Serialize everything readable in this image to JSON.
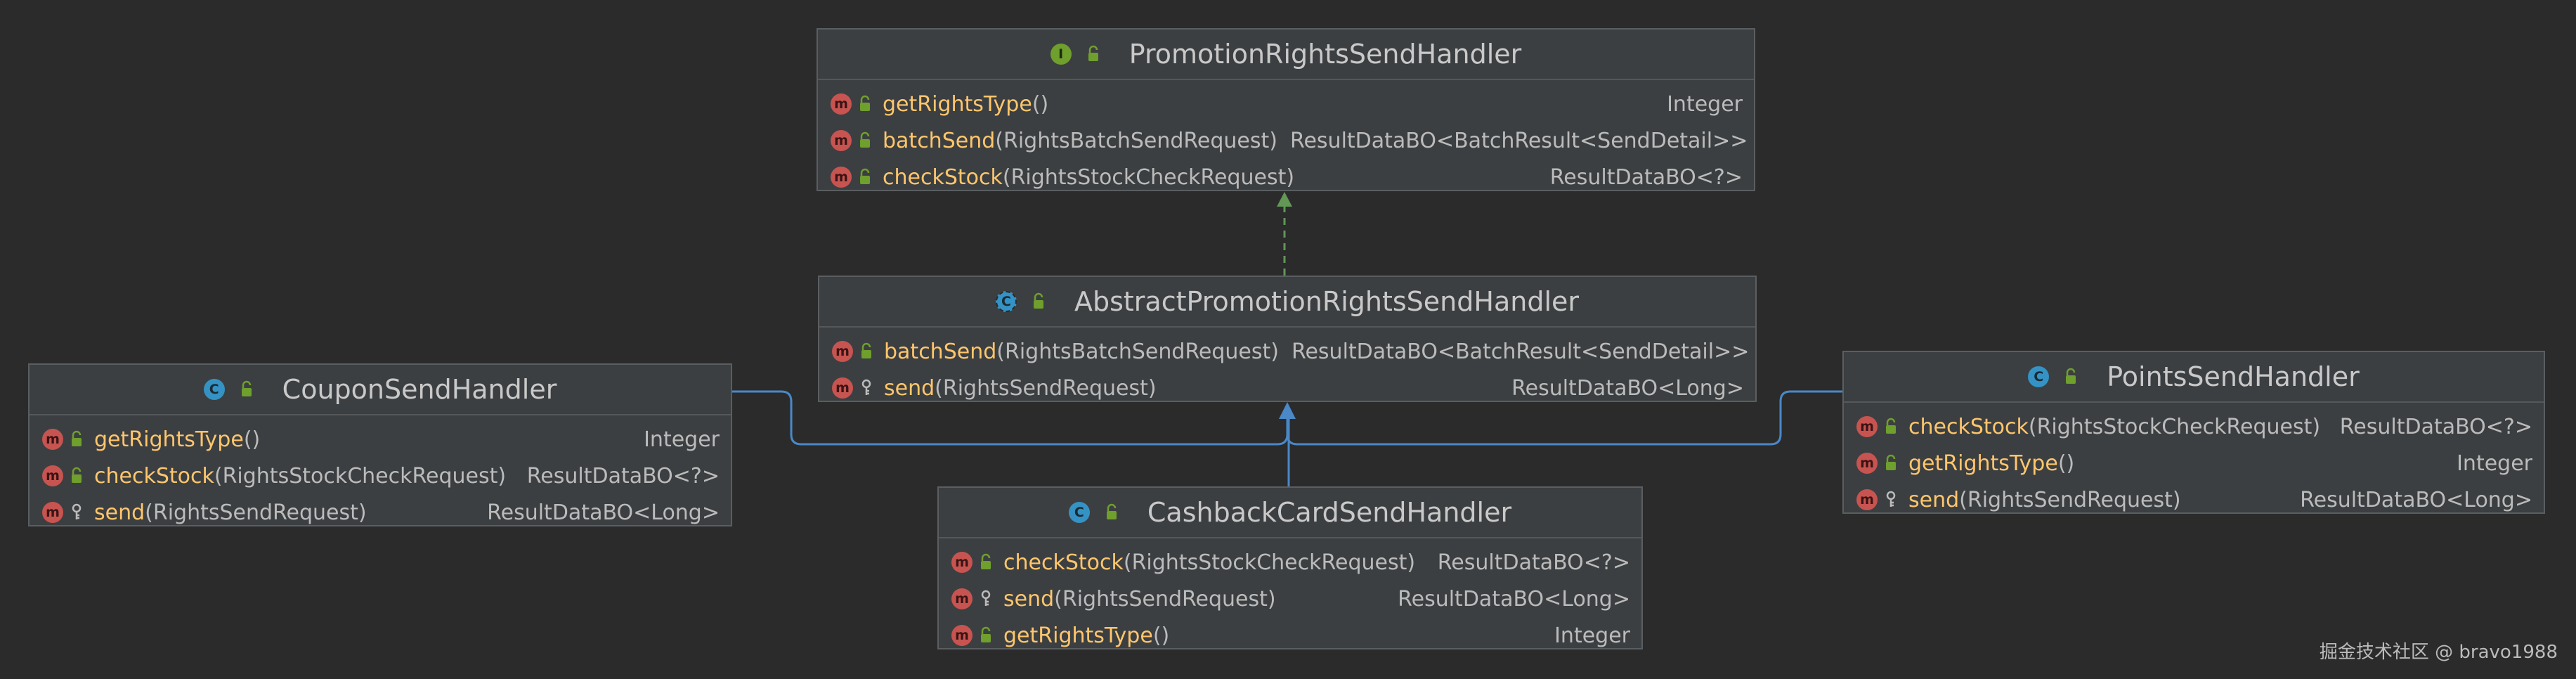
{
  "classes": {
    "promotion": {
      "name": "PromotionRightsSendHandler",
      "kind_icon": "interface-icon",
      "kind_letter": "I",
      "methods": [
        {
          "name": "getRightsType",
          "params": "()",
          "ret": "Integer",
          "visibility": "public-lock-icon"
        },
        {
          "name": "batchSend",
          "params": "(RightsBatchSendRequest)",
          "ret": "ResultDataBO<BatchResult<SendDetail>>",
          "visibility": "public-lock-icon"
        },
        {
          "name": "checkStock",
          "params": "(RightsStockCheckRequest)",
          "ret": "ResultDataBO<?>",
          "visibility": "public-lock-icon"
        }
      ]
    },
    "abstract": {
      "name": "AbstractPromotionRightsSendHandler",
      "kind_icon": "abstract-class-icon",
      "kind_letter": "C",
      "methods": [
        {
          "name": "batchSend",
          "params": "(RightsBatchSendRequest)",
          "ret": "ResultDataBO<BatchResult<SendDetail>>",
          "visibility": "public-lock-icon"
        },
        {
          "name": "send",
          "params": "(RightsSendRequest)",
          "ret": "ResultDataBO<Long>",
          "visibility": "protected-key-icon"
        }
      ]
    },
    "coupon": {
      "name": "CouponSendHandler",
      "kind_icon": "class-icon",
      "kind_letter": "C",
      "methods": [
        {
          "name": "getRightsType",
          "params": "()",
          "ret": "Integer",
          "visibility": "public-lock-icon"
        },
        {
          "name": "checkStock",
          "params": "(RightsStockCheckRequest)",
          "ret": "ResultDataBO<?>",
          "visibility": "public-lock-icon"
        },
        {
          "name": "send",
          "params": "(RightsSendRequest)",
          "ret": "ResultDataBO<Long>",
          "visibility": "protected-key-icon"
        }
      ]
    },
    "points": {
      "name": "PointsSendHandler",
      "kind_icon": "class-icon",
      "kind_letter": "C",
      "methods": [
        {
          "name": "checkStock",
          "params": "(RightsStockCheckRequest)",
          "ret": "ResultDataBO<?>",
          "visibility": "public-lock-icon"
        },
        {
          "name": "getRightsType",
          "params": "()",
          "ret": "Integer",
          "visibility": "public-lock-icon"
        },
        {
          "name": "send",
          "params": "(RightsSendRequest)",
          "ret": "ResultDataBO<Long>",
          "visibility": "protected-key-icon"
        }
      ]
    },
    "cashback": {
      "name": "CashbackCardSendHandler",
      "kind_icon": "class-icon",
      "kind_letter": "C",
      "methods": [
        {
          "name": "checkStock",
          "params": "(RightsStockCheckRequest)",
          "ret": "ResultDataBO<?>",
          "visibility": "public-lock-icon"
        },
        {
          "name": "send",
          "params": "(RightsSendRequest)",
          "ret": "ResultDataBO<Long>",
          "visibility": "protected-key-icon"
        },
        {
          "name": "getRightsType",
          "params": "()",
          "ret": "Integer",
          "visibility": "public-lock-icon"
        }
      ]
    }
  },
  "method_letter": "m",
  "watermark": "掘金技术社区 @ bravo1988",
  "colors": {
    "background": "#2b2b2b",
    "box": "#3c3f41",
    "method_name": "#ffc66d",
    "inheritance_edge": "#4a88c7",
    "realization_edge": "#629755"
  }
}
